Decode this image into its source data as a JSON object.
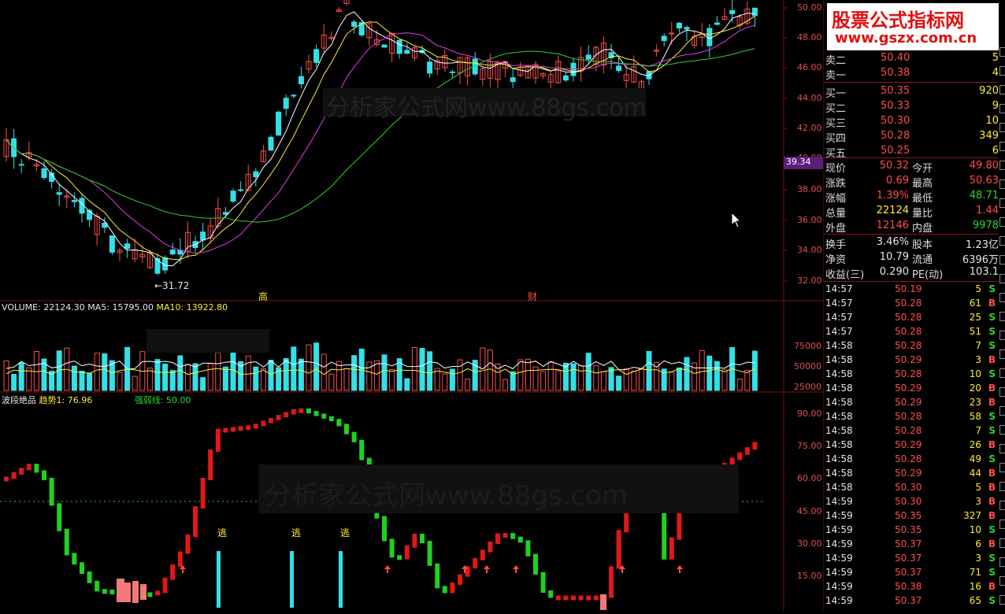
{
  "price_axis": [
    "50.00",
    "48.00",
    "46.00",
    "44.00",
    "42.00",
    "40.00",
    "38.00",
    "36.00",
    "34.00",
    "32.00"
  ],
  "volume_axis": [
    "75000",
    "50000",
    "25000"
  ],
  "indicator_axis": [
    "90.00",
    "75.00",
    "60.00",
    "45.00",
    "30.00",
    "15.00"
  ],
  "price_tag": "39.34",
  "low_label": "←31.72",
  "event_labels": [
    "高",
    "财"
  ],
  "volume_header": {
    "vol": "VOLUME: 22124.30",
    "ma5": "MA5: 15795.00",
    "ma10": "MA10: 13922.80"
  },
  "indicator_header": {
    "name": "波段绝品",
    "trend": "趋势1: 76.96",
    "strength": "强弱线: 50.00"
  },
  "escape_label": "逃",
  "watermark": "分析家公式网www.88gs.com",
  "logo": {
    "line1": "股票公式指标网",
    "line2": "www.gszx.com.cn"
  },
  "order_book": [
    {
      "label": "卖二",
      "price": "50.40",
      "vol": "5"
    },
    {
      "label": "卖一",
      "price": "50.38",
      "vol": "4"
    },
    {
      "label": "买一",
      "price": "50.35",
      "vol": "920"
    },
    {
      "label": "买二",
      "price": "50.33",
      "vol": "9"
    },
    {
      "label": "买三",
      "price": "50.30",
      "vol": "10"
    },
    {
      "label": "买四",
      "price": "50.28",
      "vol": "349"
    },
    {
      "label": "买五",
      "price": "50.25",
      "vol": "6"
    }
  ],
  "quote": [
    {
      "l1": "现价",
      "v1": "50.32",
      "c1": "red",
      "l2": "今开",
      "v2": "49.80",
      "c2": "red"
    },
    {
      "l1": "涨跌",
      "v1": "0.69",
      "c1": "red",
      "l2": "最高",
      "v2": "50.63",
      "c2": "red"
    },
    {
      "l1": "涨幅",
      "v1": "1.39%",
      "c1": "red",
      "l2": "最低",
      "v2": "48.71",
      "c2": "green"
    },
    {
      "l1": "总量",
      "v1": "22124",
      "c1": "yellow",
      "l2": "量比",
      "v2": "1.44",
      "c2": "red"
    },
    {
      "l1": "外盘",
      "v1": "12146",
      "c1": "red",
      "l2": "内盘",
      "v2": "9978",
      "c2": "green"
    }
  ],
  "fundamentals": [
    {
      "l1": "换手",
      "v1": "3.46%",
      "l2": "股本",
      "v2": "1.23亿"
    },
    {
      "l1": "净资",
      "v1": "10.79",
      "l2": "流通",
      "v2": "6396万"
    },
    {
      "l1": "收益(三)",
      "v1": "0.290",
      "l2": "PE(动)",
      "v2": "103.1"
    }
  ],
  "ticks": [
    {
      "t": "14:57",
      "p": "50.19",
      "v": "5",
      "s": "S"
    },
    {
      "t": "14:57",
      "p": "50.28",
      "v": "61",
      "s": "B"
    },
    {
      "t": "14:57",
      "p": "50.28",
      "v": "25",
      "s": "S"
    },
    {
      "t": "14:57",
      "p": "50.28",
      "v": "51",
      "s": "S"
    },
    {
      "t": "14:58",
      "p": "50.28",
      "v": "7",
      "s": "S"
    },
    {
      "t": "14:58",
      "p": "50.29",
      "v": "3",
      "s": "B"
    },
    {
      "t": "14:58",
      "p": "50.28",
      "v": "10",
      "s": "S"
    },
    {
      "t": "14:58",
      "p": "50.29",
      "v": "20",
      "s": "B"
    },
    {
      "t": "14:58",
      "p": "50.29",
      "v": "23",
      "s": "B"
    },
    {
      "t": "14:58",
      "p": "50.28",
      "v": "58",
      "s": "S"
    },
    {
      "t": "14:58",
      "p": "50.28",
      "v": "7",
      "s": "S"
    },
    {
      "t": "14:58",
      "p": "50.29",
      "v": "26",
      "s": "B"
    },
    {
      "t": "14:58",
      "p": "50.28",
      "v": "49",
      "s": "S"
    },
    {
      "t": "14:58",
      "p": "50.29",
      "v": "44",
      "s": "B"
    },
    {
      "t": "14:58",
      "p": "50.30",
      "v": "5",
      "s": "B"
    },
    {
      "t": "14:59",
      "p": "50.30",
      "v": "3",
      "s": "B"
    },
    {
      "t": "14:59",
      "p": "50.35",
      "v": "327",
      "s": "B"
    },
    {
      "t": "14:59",
      "p": "50.35",
      "v": "10",
      "s": "S"
    },
    {
      "t": "14:59",
      "p": "50.37",
      "v": "6",
      "s": "B"
    },
    {
      "t": "14:59",
      "p": "50.37",
      "v": "3",
      "s": "S"
    },
    {
      "t": "14:59",
      "p": "50.37",
      "v": "71",
      "s": "S"
    },
    {
      "t": "14:59",
      "p": "50.38",
      "v": "16",
      "s": "B"
    },
    {
      "t": "14:59",
      "p": "50.37",
      "v": "65",
      "s": "S"
    }
  ],
  "colors": {
    "up": "#ff4d4d",
    "down": "#33e0e8",
    "ma5": "#ffffff",
    "ma10": "#ffee33",
    "ma20": "#e040e0",
    "ma60": "#30d030",
    "grid": "#7a1010"
  }
}
